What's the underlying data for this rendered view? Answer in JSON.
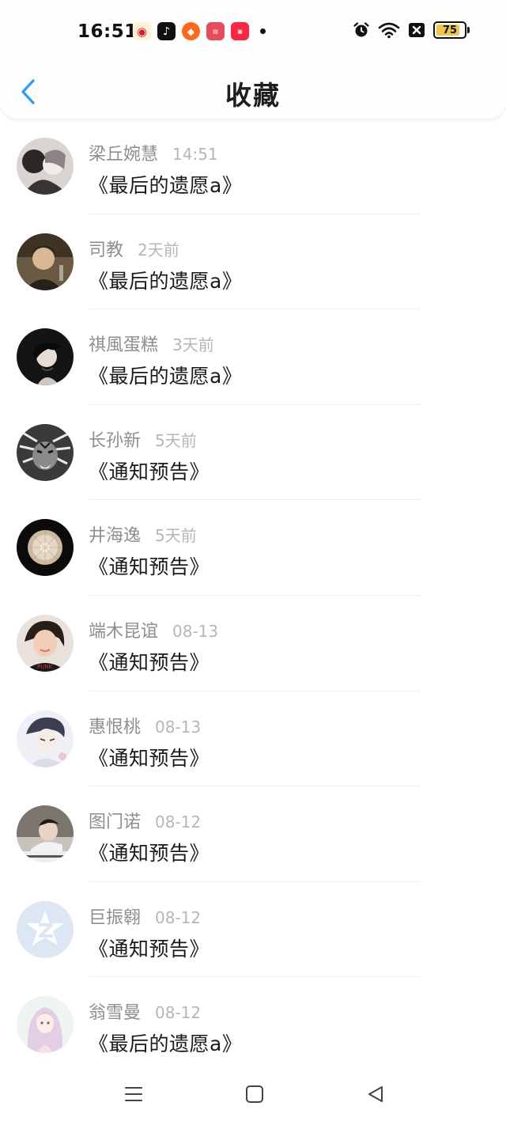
{
  "status_bar": {
    "time": "16:51",
    "battery": "75",
    "battery_level": 0.75,
    "notification_apps": [
      "weibo-icon",
      "tiktok-icon",
      "taobao-icon",
      "news-icon",
      "xiaohongshu-icon"
    ],
    "status_icons": [
      "alarm-icon",
      "wifi-icon",
      "sim-off-icon",
      "battery-icon"
    ]
  },
  "nav": {
    "back_icon": "chevron-left-icon",
    "title": "收藏",
    "accent": "#2a9df4"
  },
  "items": [
    {
      "name": "梁丘婉慧",
      "time": "14:51",
      "title": "《最后的遗愿a》"
    },
    {
      "name": "司教",
      "time": "2天前",
      "title": "《最后的遗愿a》"
    },
    {
      "name": "祺風蛋糕",
      "time": "3天前",
      "title": "《最后的遗愿a》"
    },
    {
      "name": "长孙新",
      "time": "5天前",
      "title": "《通知预告》"
    },
    {
      "name": "井海逸",
      "time": "5天前",
      "title": "《通知预告》"
    },
    {
      "name": "端木昆谊",
      "time": "08-13",
      "title": "《通知预告》"
    },
    {
      "name": "惠恨桃",
      "time": "08-13",
      "title": "《通知预告》"
    },
    {
      "name": "图门诺",
      "time": "08-12",
      "title": "《通知预告》"
    },
    {
      "name": "巨振翱",
      "time": "08-12",
      "title": "《通知预告》"
    },
    {
      "name": "翁雪曼",
      "time": "08-12",
      "title": "《最后的遗愿a》"
    }
  ],
  "system_nav": {
    "buttons": [
      "menu-icon",
      "home-icon",
      "back-triangle-icon"
    ]
  }
}
